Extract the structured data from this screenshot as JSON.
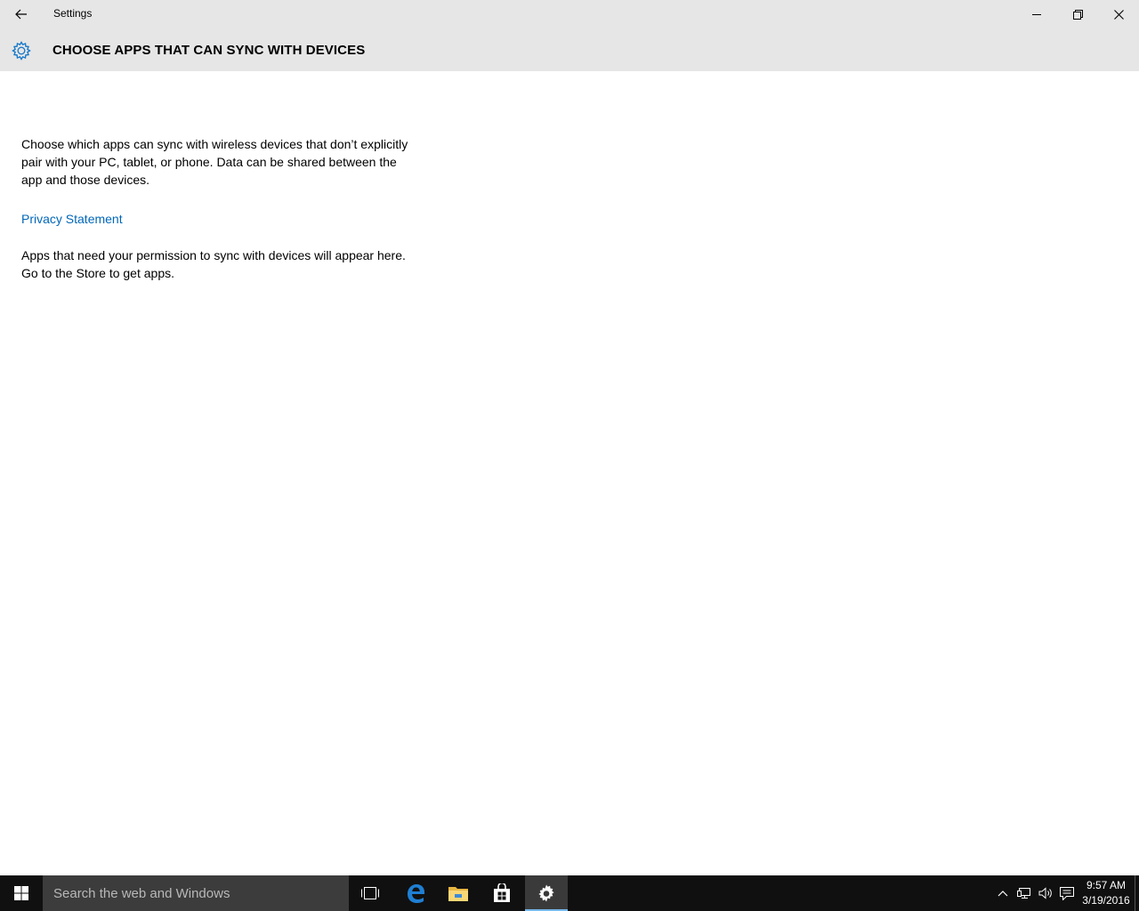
{
  "window": {
    "title": "Settings",
    "back_icon": "back-arrow-icon",
    "controls": [
      "minimize-icon",
      "restore-icon",
      "close-icon"
    ]
  },
  "header": {
    "icon": "gear-icon",
    "title": "CHOOSE APPS THAT CAN SYNC WITH DEVICES"
  },
  "content": {
    "description": "Choose which apps can sync with wireless devices that don’t explicitly pair with your PC, tablet, or phone. Data can be shared between the app and those devices.",
    "privacy_link": "Privacy Statement",
    "empty_message": "Apps that need your permission to sync with devices will appear here. Go to the Store to get apps."
  },
  "taskbar": {
    "search_placeholder": "Search the web and Windows",
    "pinned": [
      "task-view-icon",
      "edge-icon",
      "file-explorer-icon",
      "store-icon",
      "settings-icon"
    ],
    "active_app": "settings-icon",
    "tray": [
      "chevron-up-icon",
      "network-icon",
      "volume-icon",
      "action-center-icon"
    ],
    "time": "9:57 AM",
    "date": "3/19/2016"
  },
  "colors": {
    "accent": "#0067b8",
    "gear": "#1979ca",
    "header_bg": "#e6e6e6",
    "taskbar_bg": "#101010",
    "active_indicator": "#76b9ed"
  }
}
